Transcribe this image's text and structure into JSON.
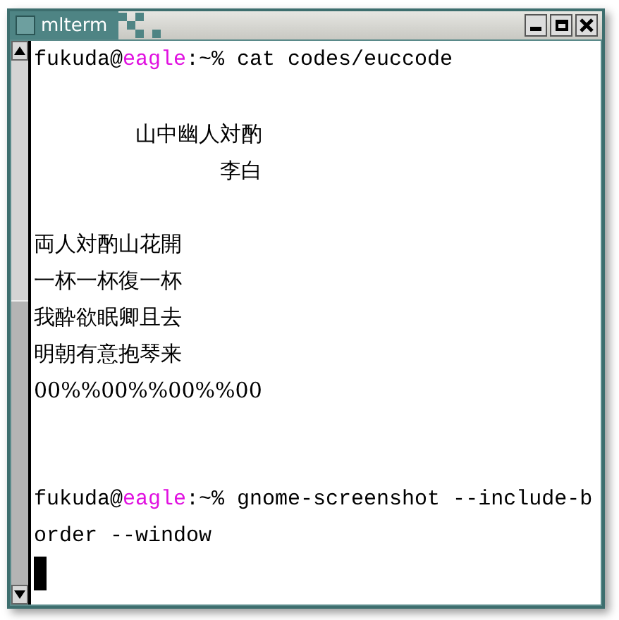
{
  "window": {
    "title": "mlterm"
  },
  "terminal": {
    "lines": [
      {
        "kind": "prompt",
        "segments": [
          {
            "text": "fukuda@",
            "kind": "plain"
          },
          {
            "text": "eagle",
            "kind": "host"
          },
          {
            "text": ":~% cat codes/euccode",
            "kind": "plain"
          }
        ]
      },
      {
        "kind": "blank"
      },
      {
        "kind": "poem",
        "heading": [
          "山中幽人対酌",
          "李白"
        ],
        "body": [
          "両人対酌山花開",
          "一杯一杯復一杯",
          "我酔欲眠卿且去",
          "明朝有意抱琴来",
          "00%%00%%00%%00"
        ]
      },
      {
        "kind": "blank"
      },
      {
        "kind": "blank"
      },
      {
        "kind": "prompt",
        "segments": [
          {
            "text": "fukuda@",
            "kind": "plain"
          },
          {
            "text": "eagle",
            "kind": "host"
          },
          {
            "text": ":~% gnome-screenshot --include-b",
            "kind": "plain"
          }
        ]
      },
      {
        "kind": "text",
        "text": "order --window"
      },
      {
        "kind": "cursor"
      }
    ]
  }
}
